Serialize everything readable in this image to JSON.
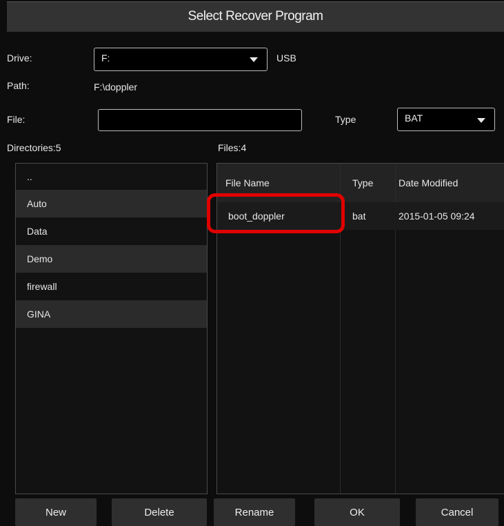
{
  "dialog": {
    "title": "Select Recover Program"
  },
  "drive": {
    "label": "Drive:",
    "value": "F:",
    "extra": "USB"
  },
  "path": {
    "label": "Path:",
    "value": "F:\\doppler"
  },
  "file": {
    "label": "File:",
    "value": ""
  },
  "type": {
    "label": "Type",
    "value": "BAT"
  },
  "directories": {
    "label": "Directories:5",
    "items": [
      "..",
      "Auto",
      "Data",
      "Demo",
      "firewall",
      "GINA"
    ]
  },
  "files": {
    "label": "Files:4",
    "columns": [
      "File Name",
      "Type",
      "Date Modified"
    ],
    "rows": [
      {
        "name": "boot_doppler",
        "type": "bat",
        "date": "2015-01-05 09:24"
      }
    ]
  },
  "buttons": {
    "new": "New",
    "delete": "Delete",
    "rename": "Rename",
    "ok": "OK",
    "cancel": "Cancel"
  },
  "colors": {
    "highlight": "#e10000",
    "background": "#0d0d0d"
  },
  "icons": {
    "dropdown": "caret-down-icon"
  }
}
